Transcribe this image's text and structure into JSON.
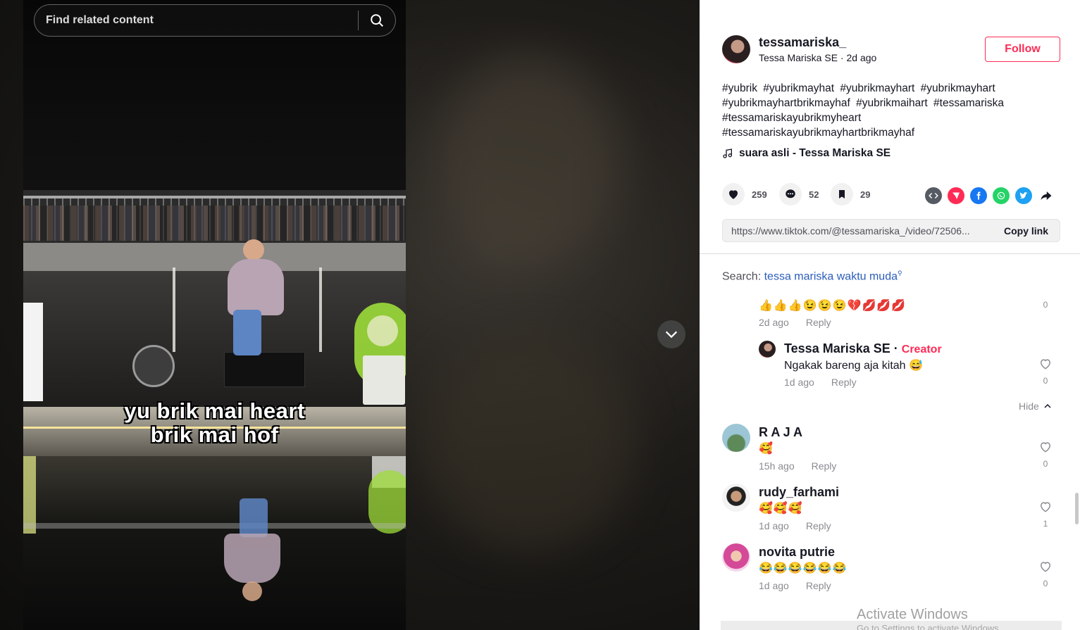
{
  "search": {
    "placeholder": "Find related content"
  },
  "video": {
    "caption_line1": "yu brik mai heart",
    "caption_line2": "brik mai hof"
  },
  "author": {
    "username": "tessamariska_",
    "display_name": "Tessa Mariska SE",
    "time": "2d ago",
    "follow_label": "Follow"
  },
  "description": {
    "hashtags": [
      "#yubrik",
      "#yubrikmayhat",
      "#yubrikmayhart",
      "#yubrikmayhart",
      "#yubrikmayhartbrikmayhaf",
      "#yubrikmaihart",
      "#tessamariska",
      "#tessamariskayubrikmyheart",
      "#tessamariskayubrikmayhartbrikmayhaf"
    ]
  },
  "music": {
    "title": "suara asli - Tessa Mariska SE"
  },
  "stats": {
    "likes": "259",
    "comments": "52",
    "saves": "29"
  },
  "share": {
    "icons": [
      "embed-icon",
      "send-icon",
      "facebook-icon",
      "whatsapp-icon",
      "twitter-icon",
      "share-arrow-icon"
    ],
    "colors": {
      "embed": "#555a63",
      "send": "#fe2c55",
      "facebook": "#1877f2",
      "whatsapp": "#25d366",
      "twitter": "#1da1f2"
    }
  },
  "link": {
    "url": "https://www.tiktok.com/@tessamariska_/video/72506...",
    "copy_label": "Copy link"
  },
  "related_search": {
    "prefix": "Search:",
    "query": "tessa mariska waktu muda"
  },
  "comments": {
    "reply_label": "Reply",
    "hide_label": "Hide",
    "creator_label": "Creator",
    "items": [
      {
        "name": "",
        "text": "👍👍👍😉😉😉💔💋💋💋",
        "time": "2d ago",
        "likes": "0"
      },
      {
        "name": "Tessa Mariska SE",
        "text": "Ngakak bareng aja kitah 😅",
        "time": "1d ago",
        "likes": "0"
      },
      {
        "name": "R A J A",
        "text": "🥰",
        "time": "15h ago",
        "likes": "0"
      },
      {
        "name": "rudy_farhami",
        "text": "🥰🥰🥰",
        "time": "1d ago",
        "likes": "1"
      },
      {
        "name": "novita putrie",
        "text": "😂😂😂😂😂😂",
        "time": "1d ago",
        "likes": "0"
      }
    ]
  },
  "windows_watermark": {
    "title": "Activate Windows",
    "subtitle": "Go to Settings to activate Windows."
  },
  "accent_color": "#fe2c55"
}
